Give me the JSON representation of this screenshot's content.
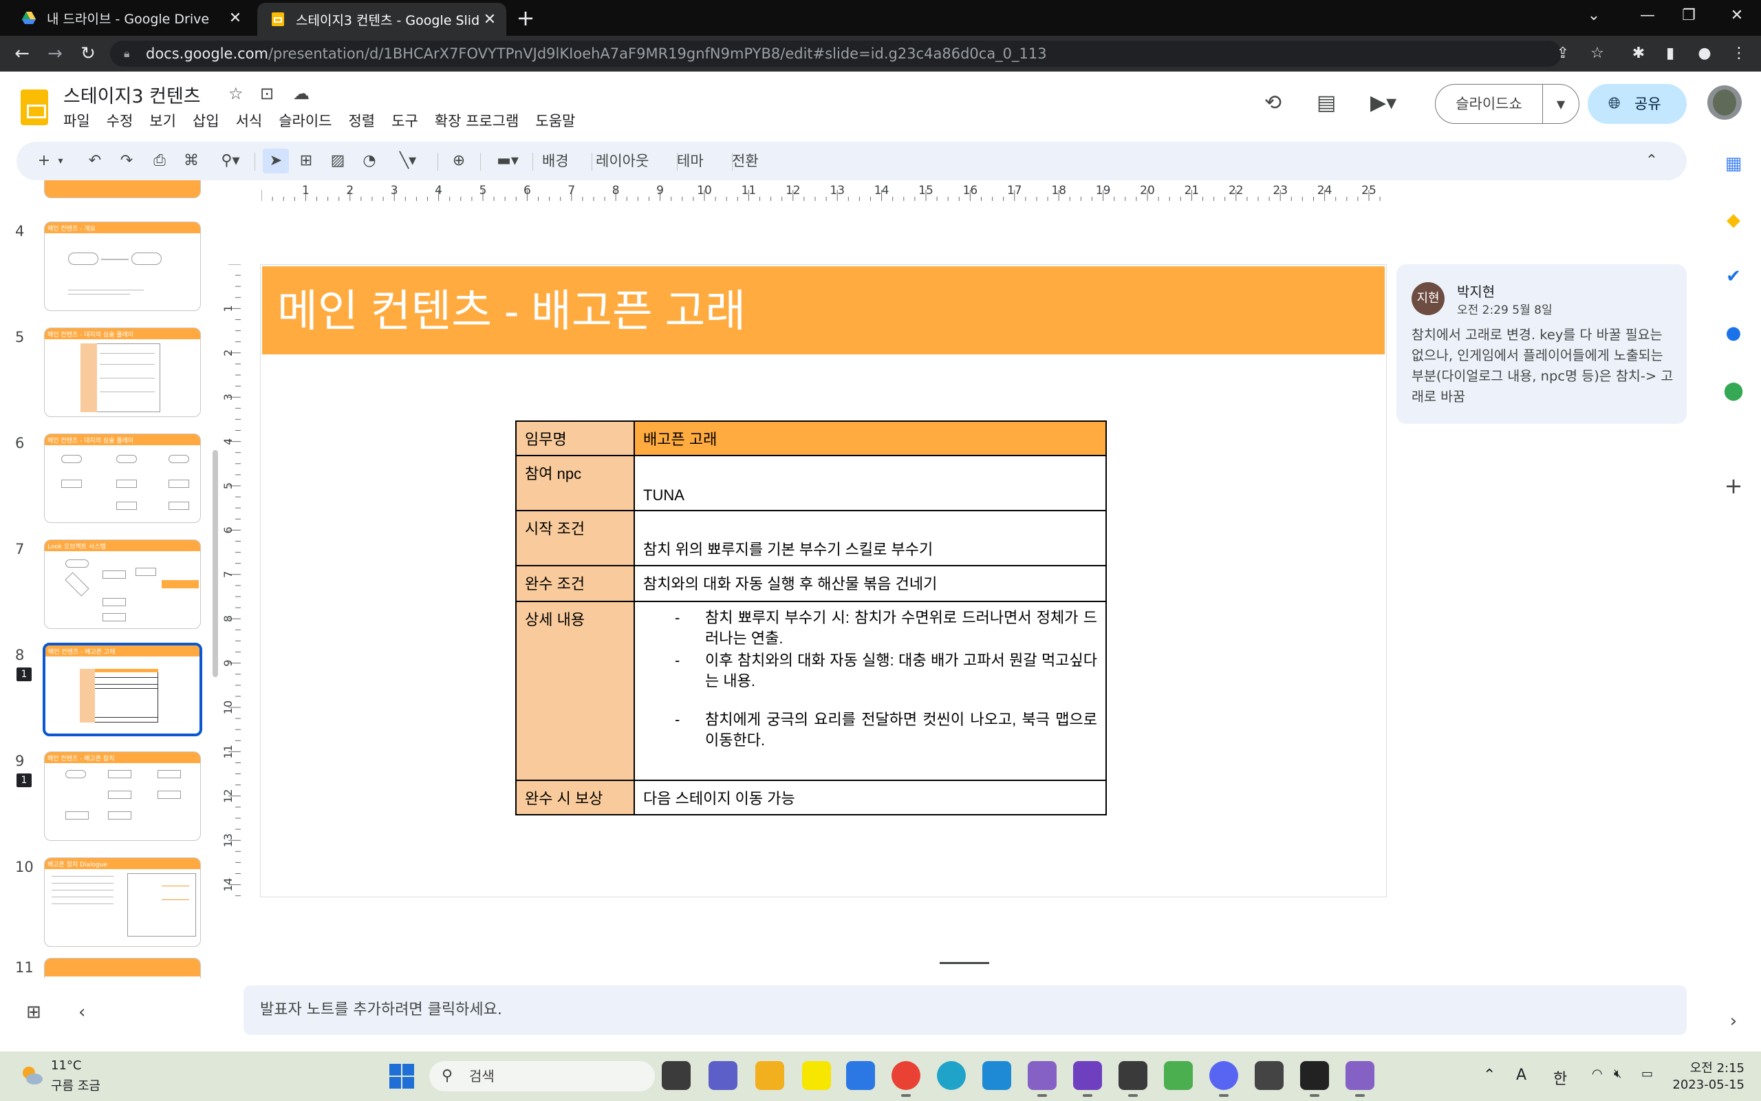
{
  "browser": {
    "tabs": [
      {
        "title": "내 드라이브 - Google Drive",
        "active": false
      },
      {
        "title": "스테이지3 컨텐츠 - Google Slides",
        "active": true
      }
    ],
    "url_host": "docs.google.com",
    "url_path": "/presentation/d/1BHCArX7FOVYTPnVJd9lKIoehA7aF9MR19gnfN9mPYB8/edit#slide=id.g23c4a86d0ca_0_113"
  },
  "doc": {
    "title": "스테이지3 컨텐츠",
    "menu": [
      "파일",
      "수정",
      "보기",
      "삽입",
      "서식",
      "슬라이드",
      "정렬",
      "도구",
      "확장 프로그램",
      "도움말"
    ],
    "slideshow_label": "슬라이드쇼",
    "share_label": "공유"
  },
  "toolbar": {
    "background_label": "배경",
    "layout_label": "레이아웃",
    "theme_label": "테마",
    "transition_label": "전환"
  },
  "ruler": {
    "h_ticks": [
      "1",
      "2",
      "3",
      "4",
      "5",
      "6",
      "7",
      "8",
      "9",
      "10",
      "11",
      "12",
      "13",
      "14",
      "15",
      "16",
      "17",
      "18",
      "19",
      "20",
      "21",
      "22",
      "23",
      "24",
      "25"
    ],
    "v_ticks": [
      "1",
      "2",
      "3",
      "4",
      "5",
      "6",
      "7",
      "8",
      "9",
      "10",
      "11",
      "12",
      "13",
      "14"
    ]
  },
  "filmstrip": [
    {
      "num": "4",
      "title": "메인 컨텐츠 - 개요"
    },
    {
      "num": "5",
      "title": "메인 컨텐츠 - 대지의 심술 플레이"
    },
    {
      "num": "6",
      "title": "메인 컨텐츠 - 대지의 심술 플레이"
    },
    {
      "num": "7",
      "title": "Look 오브젝트 시스템"
    },
    {
      "num": "8",
      "title": "메인 컨텐츠 - 배고픈 고래",
      "selected": true,
      "comments": "1"
    },
    {
      "num": "9",
      "title": "메인 컨텐츠 - 배고픈 참치",
      "comments": "1"
    },
    {
      "num": "10",
      "title": "배고픈 참치 Dialogue"
    },
    {
      "num": "11",
      "title": ""
    }
  ],
  "slide": {
    "title": "메인 컨텐츠 - 배고픈 고래",
    "table": {
      "mission_name_label": "임무명",
      "mission_name_value": "배고픈 고래",
      "npc_label": "참여 npc",
      "npc_value": "TUNA",
      "start_label": "시작 조건",
      "start_value": "참치 위의 뾰루지를 기본 부수기 스킬로 부수기",
      "complete_label": "완수 조건",
      "complete_value": "참치와의 대화 자동 실행 후 해산물 볶음 건네기",
      "detail_label": "상세 내용",
      "details": [
        "참치 뾰루지 부수기 시: 참치가 수면위로 드러나면서 정체가 드러나는 연출.",
        "이후 참치와의 대화 자동 실행: 대충 배가 고파서 뭔갈 먹고싶다는 내용.",
        "참치에게 궁극의 요리를 전달하면 컷씬이 나오고, 북극 맵으로 이동한다."
      ],
      "reward_label": "완수 시 보상",
      "reward_value": "다음 스테이지 이동 가능"
    }
  },
  "comment": {
    "avatar_text": "지현",
    "author": "박지현",
    "time": "오전 2:29 5월 8일",
    "body": "참치에서 고래로 변경. key를 다 바꿀 필요는 없으나, 인게임에서 플레이어들에게 노출되는 부분(다이얼로그 내용, npc명 등)은 참치-> 고래로 바꿈"
  },
  "notes": {
    "placeholder": "발표자 노트를 추가하려면 클릭하세요."
  },
  "taskbar": {
    "temperature": "11°C",
    "weather": "구름 조금",
    "search_label": "검색",
    "ime_a": "A",
    "ime_han": "한",
    "clock_time": "오전 2:15",
    "clock_date": "2023-05-15"
  },
  "colors": {
    "accent_orange": "#ffab40",
    "label_peach": "#f9cb9c",
    "selection_blue": "#0b57d0"
  }
}
